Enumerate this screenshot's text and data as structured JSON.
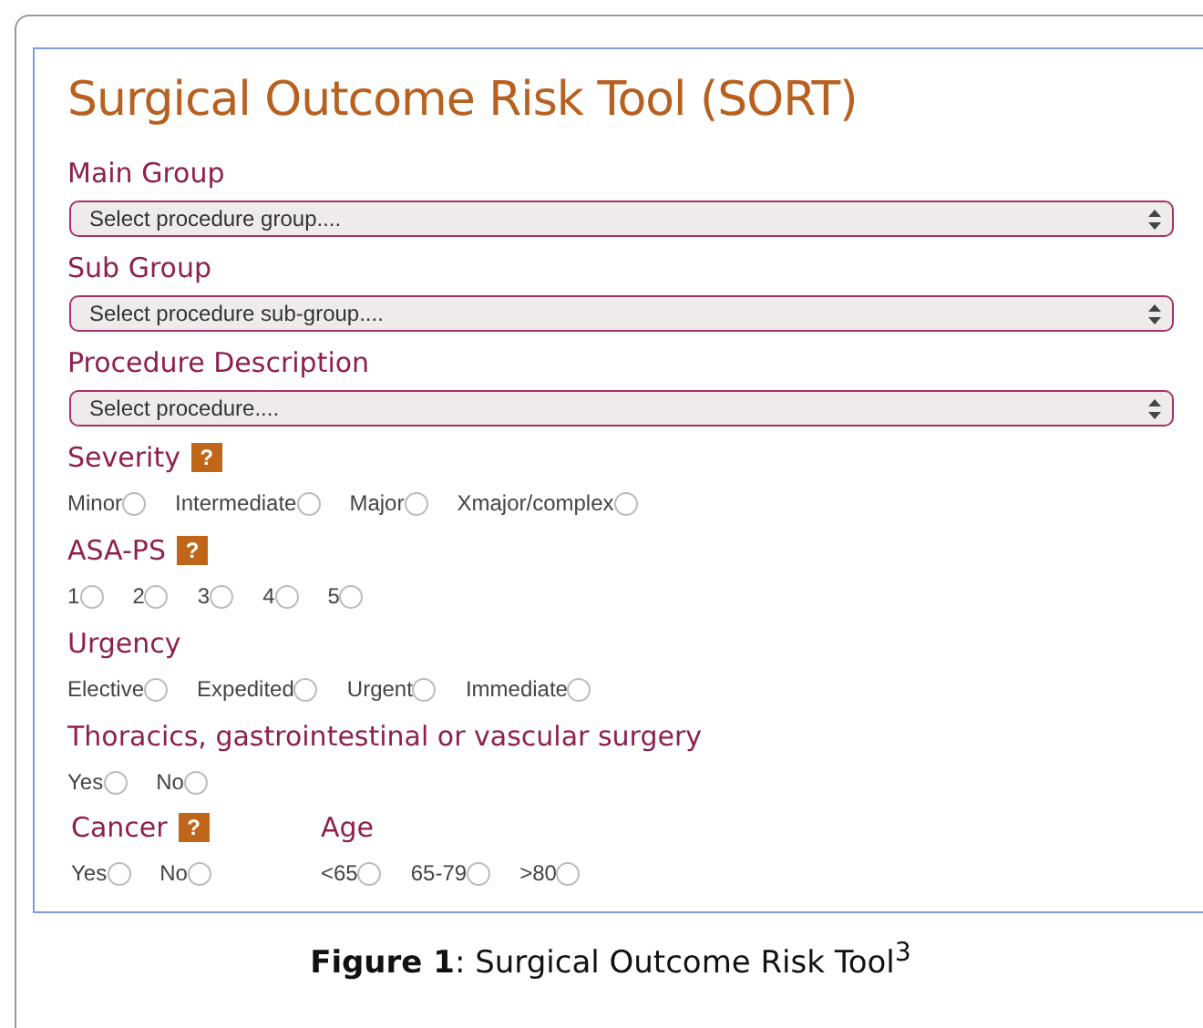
{
  "title": "Surgical Outcome Risk Tool (SORT)",
  "sections": [
    {
      "label": "Main Group",
      "kind": "select",
      "placeholder": "Select procedure group...."
    },
    {
      "label": "Sub Group",
      "kind": "select",
      "placeholder": "Select procedure sub-group...."
    },
    {
      "label": "Procedure Description",
      "kind": "select",
      "placeholder": "Select procedure...."
    },
    {
      "label": "Severity",
      "help": "?",
      "kind": "radios",
      "options": [
        {
          "label": "Minor",
          "selected": false
        },
        {
          "label": "Intermediate",
          "selected": false
        },
        {
          "label": "Major",
          "selected": false
        },
        {
          "label": "Xmajor/complex",
          "selected": false
        }
      ]
    },
    {
      "label": "ASA-PS",
      "help": "?",
      "kind": "radios",
      "options": [
        {
          "label": "1",
          "selected": false
        },
        {
          "label": "2",
          "selected": false
        },
        {
          "label": "3",
          "selected": false
        },
        {
          "label": "4",
          "selected": false
        },
        {
          "label": "5",
          "selected": false
        }
      ]
    },
    {
      "label": "Urgency",
      "kind": "radios",
      "options": [
        {
          "label": "Elective",
          "selected": false
        },
        {
          "label": "Expedited",
          "selected": false
        },
        {
          "label": "Urgent",
          "selected": false
        },
        {
          "label": "Immediate",
          "selected": false
        }
      ]
    },
    {
      "label": "Thoracics, gastrointestinal or vascular surgery",
      "kind": "radios",
      "options": [
        {
          "label": "Yes",
          "selected": false
        },
        {
          "label": "No",
          "selected": false
        }
      ]
    }
  ],
  "side_by_side": [
    {
      "label": "Cancer",
      "help": "?",
      "kind": "radios",
      "options": [
        {
          "label": "Yes",
          "selected": false
        },
        {
          "label": "No",
          "selected": false
        }
      ]
    },
    {
      "label": "Age",
      "kind": "radios",
      "options": [
        {
          "label": "<65",
          "selected": false
        },
        {
          "label": "65-79",
          "selected": false
        },
        {
          "label": ">80",
          "selected": false
        }
      ]
    }
  ],
  "caption": "**Figure 1**: Surgical Outcome Risk Tool$^{3}$"
}
